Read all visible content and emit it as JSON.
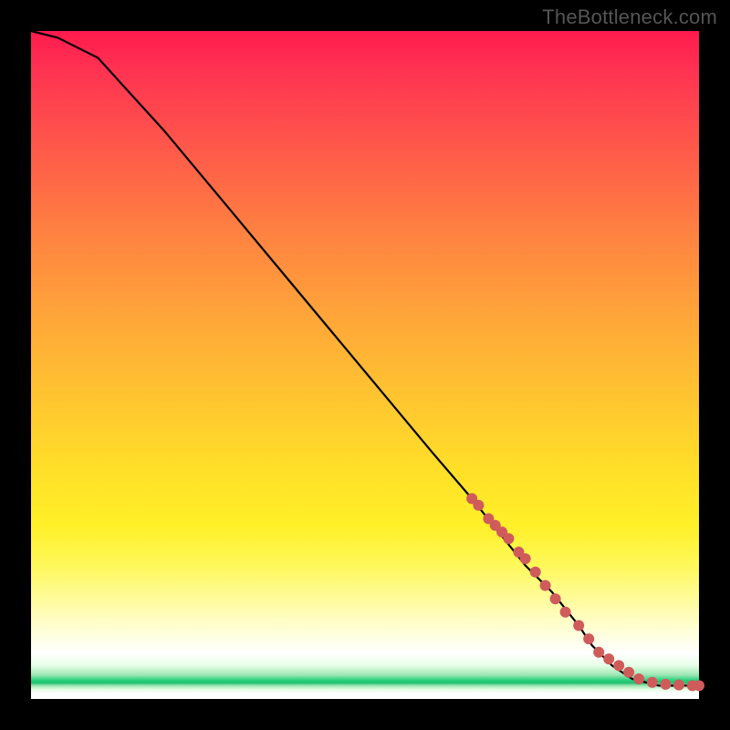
{
  "watermark": "TheBottleneck.com",
  "chart_data": {
    "type": "line",
    "title": "",
    "xlabel": "",
    "ylabel": "",
    "xlim": [
      0,
      100
    ],
    "ylim": [
      0,
      100
    ],
    "grid": false,
    "legend": false,
    "series": [
      {
        "name": "curve",
        "style": "line-black",
        "x": [
          0,
          4,
          10,
          20,
          30,
          40,
          50,
          60,
          66,
          70,
          74,
          78,
          82,
          84,
          87,
          90,
          94,
          100
        ],
        "y": [
          100,
          99,
          96,
          85,
          73,
          61,
          49,
          37,
          30,
          25,
          20,
          16,
          11,
          8,
          5,
          3,
          2,
          2
        ]
      },
      {
        "name": "highlight-dots",
        "style": "dots-red",
        "x": [
          66,
          67,
          68.5,
          69.5,
          70.5,
          71.5,
          73,
          74,
          75.5,
          77,
          78.5,
          80,
          82,
          83.5,
          85,
          86.5,
          88,
          89.5,
          91,
          93,
          95,
          97,
          99,
          100
        ],
        "y": [
          30,
          29,
          27,
          26,
          25,
          24,
          22,
          21,
          19,
          17,
          15,
          13,
          11,
          9,
          7,
          6,
          5,
          4,
          3,
          2.5,
          2.2,
          2.1,
          2,
          2
        ]
      }
    ]
  }
}
